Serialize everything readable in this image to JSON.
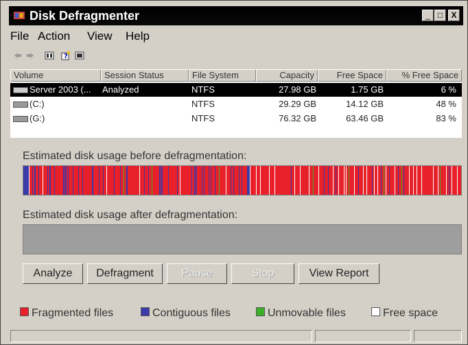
{
  "window": {
    "title": "Disk Defragmenter",
    "controls": {
      "minimize": "_",
      "maximize": "□",
      "close": "X"
    }
  },
  "menu": {
    "items": [
      {
        "label": "File"
      },
      {
        "label": "Action"
      },
      {
        "label": "View"
      },
      {
        "label": "Help"
      }
    ]
  },
  "toolbar": {
    "icons": [
      "back-icon",
      "forward-icon",
      "properties-icon",
      "help-icon",
      "console-icon"
    ]
  },
  "volumes": {
    "columns": [
      "Volume",
      "Session Status",
      "File System",
      "Capacity",
      "Free Space",
      "% Free Space"
    ],
    "rows": [
      {
        "volume": "Server 2003 (...",
        "status": "Analyzed",
        "fs": "NTFS",
        "capacity": "27.98 GB",
        "free": "1.75 GB",
        "pct": "6 %",
        "selected": true
      },
      {
        "volume": "(C:)",
        "status": "",
        "fs": "NTFS",
        "capacity": "29.29 GB",
        "free": "14.12 GB",
        "pct": "48 %",
        "selected": false
      },
      {
        "volume": "(G:)",
        "status": "",
        "fs": "NTFS",
        "capacity": "76.32 GB",
        "free": "63.46 GB",
        "pct": "83 %",
        "selected": false
      }
    ]
  },
  "analysis": {
    "before_label": "Estimated disk usage before defragmentation:",
    "after_label": "Estimated disk usage after defragmentation:"
  },
  "buttons": {
    "analyze": "Analyze",
    "defragment": "Defragment",
    "pause": "Pause",
    "stop": "Stop",
    "view_report": "View Report"
  },
  "legend": {
    "fragmented": {
      "label": "Fragmented files",
      "color": "#e8202a"
    },
    "contiguous": {
      "label": "Contiguous files",
      "color": "#3a3aa8"
    },
    "unmovable": {
      "label": "Unmovable files",
      "color": "#3cb028"
    },
    "free": {
      "label": "Free space",
      "color": "#ffffff"
    }
  }
}
